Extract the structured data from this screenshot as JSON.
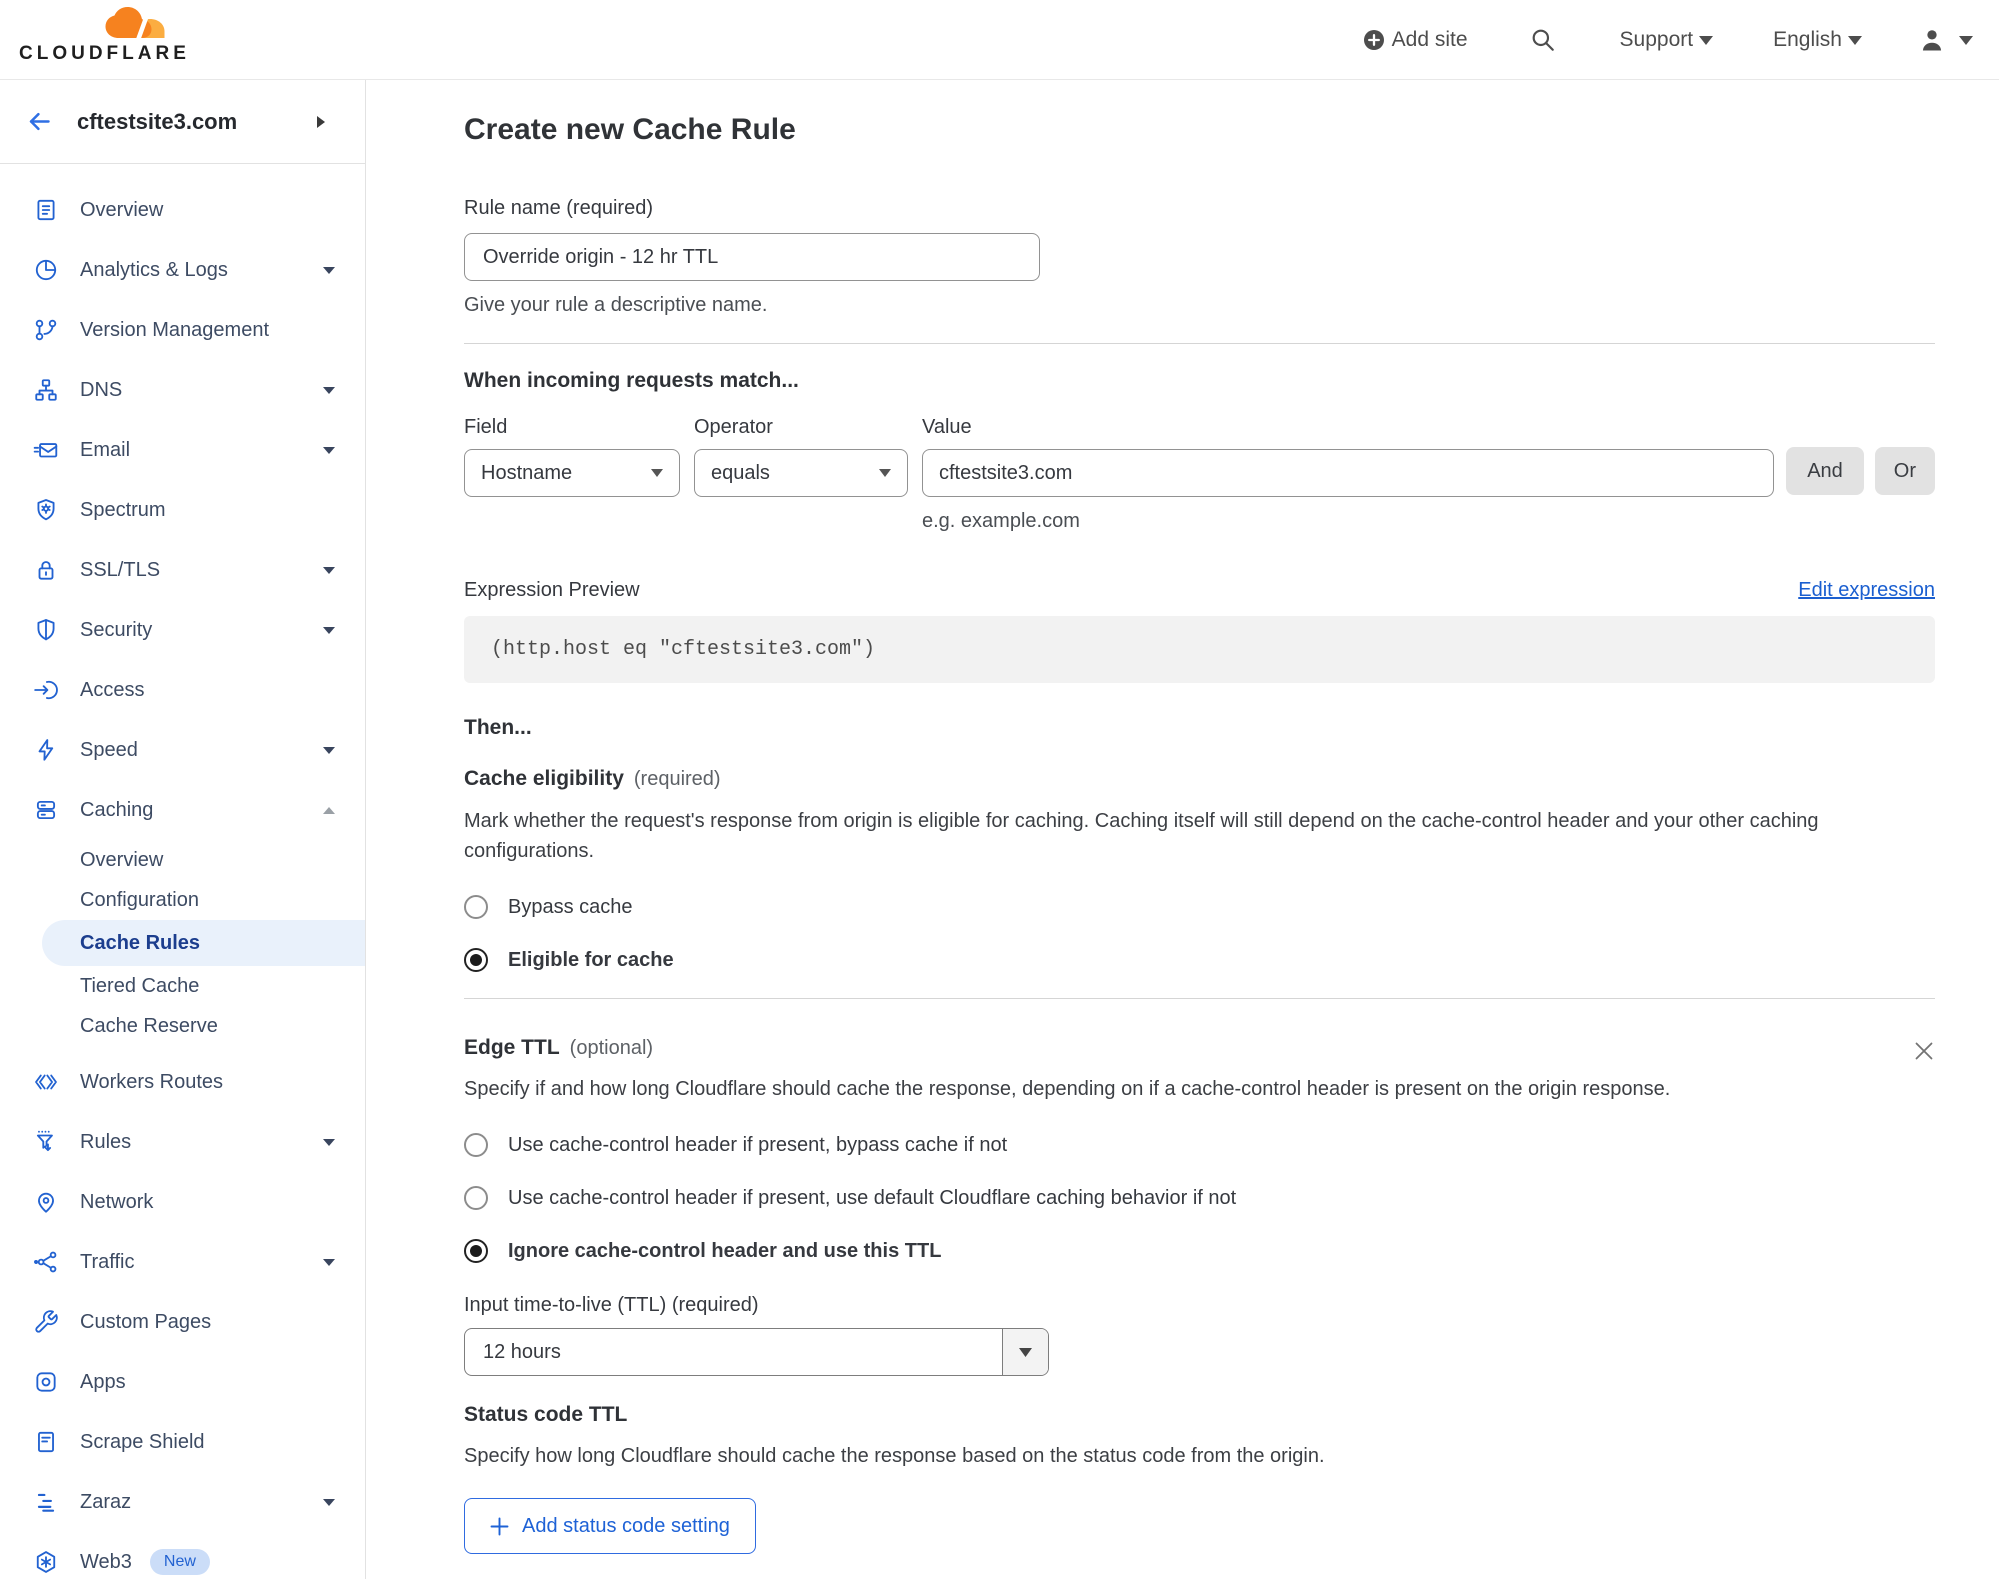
{
  "colors": {
    "accent_blue": "#2262d1",
    "link_blue": "#1b5fd0",
    "logo_orange": "#f6821f",
    "logo_orange_light": "#fbad41",
    "active_item_bg": "#e9f1fb",
    "active_item_text": "#1c3e8e"
  },
  "header": {
    "logo_text": "CLOUDFLARE",
    "add_site_label": "Add site",
    "support_label": "Support",
    "language_label": "English"
  },
  "sidebar": {
    "site_name": "cftestsite3.com",
    "items": [
      {
        "label": "Overview"
      },
      {
        "label": "Analytics & Logs",
        "expandable": true
      },
      {
        "label": "Version Management"
      },
      {
        "label": "DNS",
        "expandable": true
      },
      {
        "label": "Email",
        "expandable": true
      },
      {
        "label": "Spectrum"
      },
      {
        "label": "SSL/TLS",
        "expandable": true
      },
      {
        "label": "Security",
        "expandable": true
      },
      {
        "label": "Access"
      },
      {
        "label": "Speed",
        "expandable": true
      },
      {
        "label": "Caching",
        "expandable": true,
        "expanded": true,
        "children": [
          {
            "label": "Overview",
            "active": false
          },
          {
            "label": "Configuration",
            "active": false
          },
          {
            "label": "Cache Rules",
            "active": true
          },
          {
            "label": "Tiered Cache",
            "active": false
          },
          {
            "label": "Cache Reserve",
            "active": false
          }
        ]
      },
      {
        "label": "Workers Routes"
      },
      {
        "label": "Rules",
        "expandable": true
      },
      {
        "label": "Network"
      },
      {
        "label": "Traffic",
        "expandable": true
      },
      {
        "label": "Custom Pages"
      },
      {
        "label": "Apps"
      },
      {
        "label": "Scrape Shield"
      },
      {
        "label": "Zaraz",
        "expandable": true
      },
      {
        "label": "Web3",
        "badge": "New"
      }
    ]
  },
  "main": {
    "title": "Create new Cache Rule",
    "rule_name": {
      "label": "Rule name (required)",
      "value": "Override origin - 12 hr TTL",
      "help": "Give your rule a descriptive name."
    },
    "match": {
      "heading": "When incoming requests match...",
      "field_label": "Field",
      "operator_label": "Operator",
      "value_label": "Value",
      "field_value": "Hostname",
      "operator_value": "equals",
      "value": "cftestsite3.com",
      "value_help": "e.g. example.com",
      "and_label": "And",
      "or_label": "Or"
    },
    "expression": {
      "label": "Expression Preview",
      "edit_link": "Edit expression",
      "code": "(http.host eq \"cftestsite3.com\")"
    },
    "then_heading": "Then...",
    "cache_eligibility": {
      "heading": "Cache eligibility",
      "qualifier": "(required)",
      "description": "Mark whether the request's response from origin is eligible for caching. Caching itself will still depend on the cache-control header and your other caching configurations.",
      "options": [
        {
          "label": "Bypass cache",
          "selected": false
        },
        {
          "label": "Eligible for cache",
          "selected": true
        }
      ]
    },
    "edge_ttl": {
      "heading": "Edge TTL",
      "qualifier": "(optional)",
      "description": "Specify if and how long Cloudflare should cache the response, depending on if a cache-control header is present on the origin response.",
      "options": [
        {
          "label": "Use cache-control header if present, bypass cache if not",
          "selected": false
        },
        {
          "label": "Use cache-control header if present, use default Cloudflare caching behavior if not",
          "selected": false
        },
        {
          "label": "Ignore cache-control header and use this TTL",
          "selected": true
        }
      ],
      "ttl_label": "Input time-to-live (TTL) (required)",
      "ttl_value": "12 hours"
    },
    "status_code_ttl": {
      "heading": "Status code TTL",
      "description": "Specify how long Cloudflare should cache the response based on the status code from the origin.",
      "add_button_label": "Add status code setting"
    }
  }
}
